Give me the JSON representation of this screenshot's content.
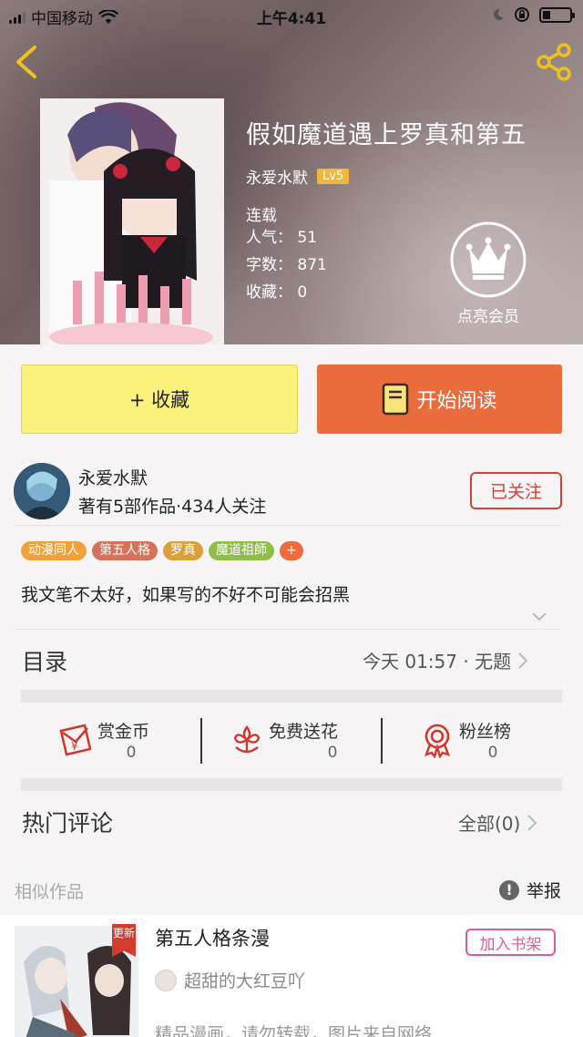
{
  "status_bar": {
    "carrier": "中国移动",
    "time": "上午4:41"
  },
  "book": {
    "title": "假如魔道遇上罗真和第五",
    "author": "永爱水默",
    "level": "Lv5",
    "state": "连载",
    "popularity": "人气：  51",
    "word_count": "字数：  871",
    "favorites": "收藏：  0"
  },
  "vip": {
    "label": "点亮会员"
  },
  "actions": {
    "collect": "+ 收藏",
    "read": "开始阅读"
  },
  "author_section": {
    "name": "永爱水默",
    "meta": "著有5部作品·434人关注",
    "follow": "已关注"
  },
  "tags": [
    {
      "label": "动漫同人",
      "color": "#f0a13a"
    },
    {
      "label": "第五人格",
      "color": "#d4735a"
    },
    {
      "label": "罗真",
      "color": "#d9a13a"
    },
    {
      "label": "魔道祖師",
      "color": "#8fbf4a"
    },
    {
      "label": "+",
      "color": "#ec6b3f"
    }
  ],
  "description": "我文笔不太好，如果写的不好不可能会招黑",
  "catalog": {
    "title": "目录",
    "latest": "今天 01:57 · 无题"
  },
  "rewards": [
    {
      "label": "赏金币",
      "count": "0",
      "icon": "red-envelope-icon"
    },
    {
      "label": "免费送花",
      "count": "0",
      "icon": "flower-icon"
    },
    {
      "label": "粉丝榜",
      "count": "0",
      "icon": "medal-icon"
    }
  ],
  "comments": {
    "title": "热门评论",
    "all": "全部(0)"
  },
  "similar": {
    "label": "相似作品",
    "report": "举报",
    "item": {
      "badge": "更新",
      "title": "第五人格条漫",
      "shelf": "加入书架",
      "author": "超甜的大红豆吖",
      "desc": "精品漫画，请勿转载，图片来自网络"
    }
  }
}
